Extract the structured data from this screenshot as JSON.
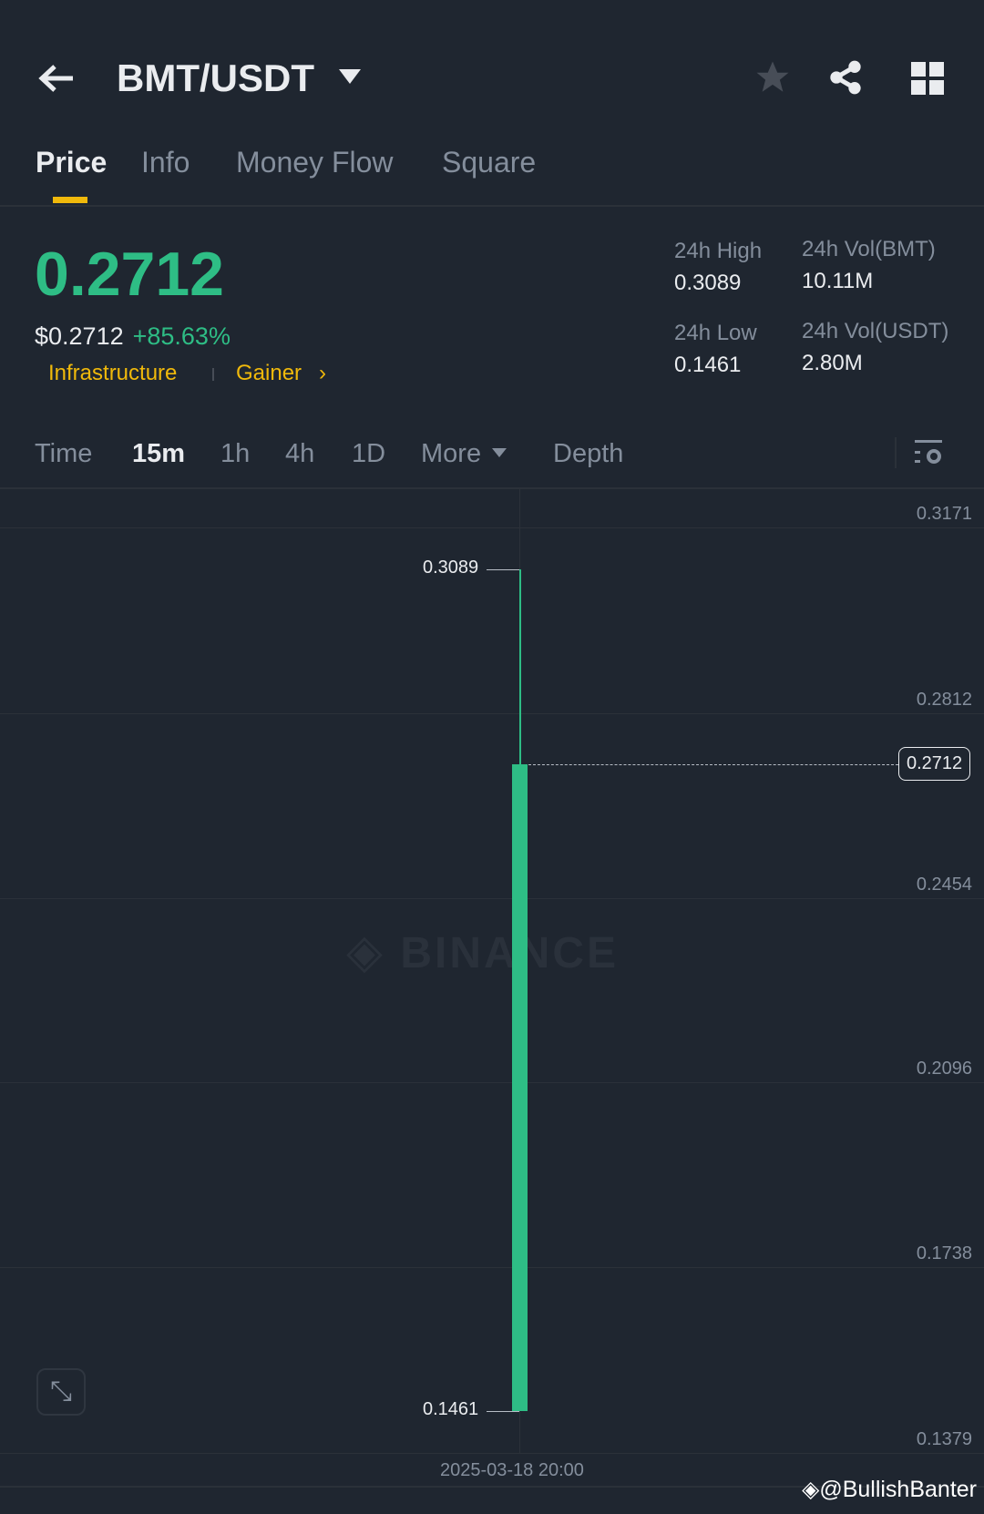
{
  "header": {
    "title": "BMT/USDT"
  },
  "tabs": [
    "Price",
    "Info",
    "Money Flow",
    "Square"
  ],
  "ticker": {
    "price": "0.2712",
    "usd_price": "$0.2712",
    "change": "+85.63%",
    "tags": [
      "Infrastructure",
      "Gainer"
    ]
  },
  "stats": {
    "high_label": "24h High",
    "high": "0.3089",
    "low_label": "24h Low",
    "low": "0.1461",
    "vol_base_label": "24h Vol(BMT)",
    "vol_base": "10.11M",
    "vol_quote_label": "24h Vol(USDT)",
    "vol_quote": "2.80M"
  },
  "intervals": [
    "Time",
    "15m",
    "1h",
    "4h",
    "1D",
    "More",
    "Depth"
  ],
  "chart_data": {
    "type": "candlestick",
    "y_ticks": [
      "0.3171",
      "0.2812",
      "0.2454",
      "0.2096",
      "0.1738",
      "0.1379"
    ],
    "ylim": [
      0.1379,
      0.3171
    ],
    "candles": [
      {
        "time": "2025-03-18 20:00",
        "open": 0.1461,
        "high": 0.3089,
        "low": 0.1461,
        "close": 0.2712
      }
    ],
    "high_label": "0.3089",
    "low_label": "0.1461",
    "current_label": "0.2712",
    "x_label": "2025-03-18 20:00",
    "watermark": "BINANCE",
    "up_color": "#2ebd85"
  },
  "credit": "@BullishBanter"
}
